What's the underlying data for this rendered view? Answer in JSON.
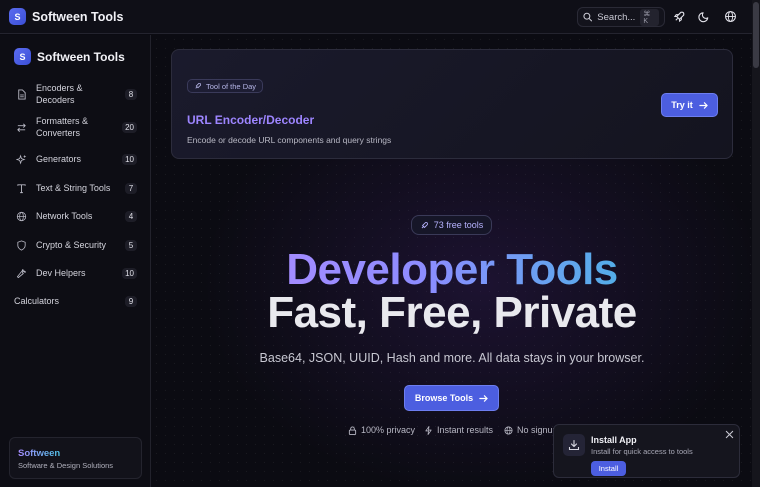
{
  "app": {
    "brand_initial": "S",
    "brand_name": "Softween Tools"
  },
  "topbar": {
    "search_label": "Search...",
    "search_shortcut": "⌘ K",
    "icons": [
      "search-icon",
      "rocket-icon",
      "moon-icon",
      "globe-icon"
    ]
  },
  "sidebar": {
    "brand_initial": "S",
    "brand_name": "Softween Tools",
    "items": [
      {
        "label": "Encoders & Decoders",
        "count": "8",
        "icon": "file-icon"
      },
      {
        "label": "Formatters & Converters",
        "count": "20",
        "icon": "arrows-icon"
      },
      {
        "label": "Generators",
        "count": "10",
        "icon": "sparkles-icon"
      },
      {
        "label": "Text & String Tools",
        "count": "7",
        "icon": "type-icon"
      },
      {
        "label": "Network Tools",
        "count": "4",
        "icon": "globe-icon"
      },
      {
        "label": "Crypto & Security",
        "count": "5",
        "icon": "shield-icon"
      },
      {
        "label": "Dev Helpers",
        "count": "10",
        "icon": "wrench-icon"
      },
      {
        "label": "Calculators",
        "count": "9",
        "icon": ""
      }
    ],
    "footer": {
      "title": "Softween",
      "subtitle": "Software & Design Solutions"
    }
  },
  "tool_of_day": {
    "badge": "Tool of the Day",
    "title": "URL Encoder/Decoder",
    "description": "Encode or decode URL components and query strings",
    "cta": "Try it"
  },
  "hero": {
    "pill": "73 free tools",
    "line1": "Developer Tools",
    "line2": "Fast, Free, Private",
    "subtitle": "Base64, JSON, UUID, Hash and more. All data stays in your browser.",
    "cta": "Browse Tools",
    "features": [
      "100% privacy",
      "Instant results",
      "No signup"
    ]
  },
  "install_toast": {
    "title": "Install App",
    "subtitle": "Install for quick access to tools",
    "button": "Install"
  },
  "colors": {
    "accent": "#4c5ee0",
    "background": "#0b0b12",
    "gradient_start": "#b98cff",
    "gradient_end": "#43c9e0"
  }
}
